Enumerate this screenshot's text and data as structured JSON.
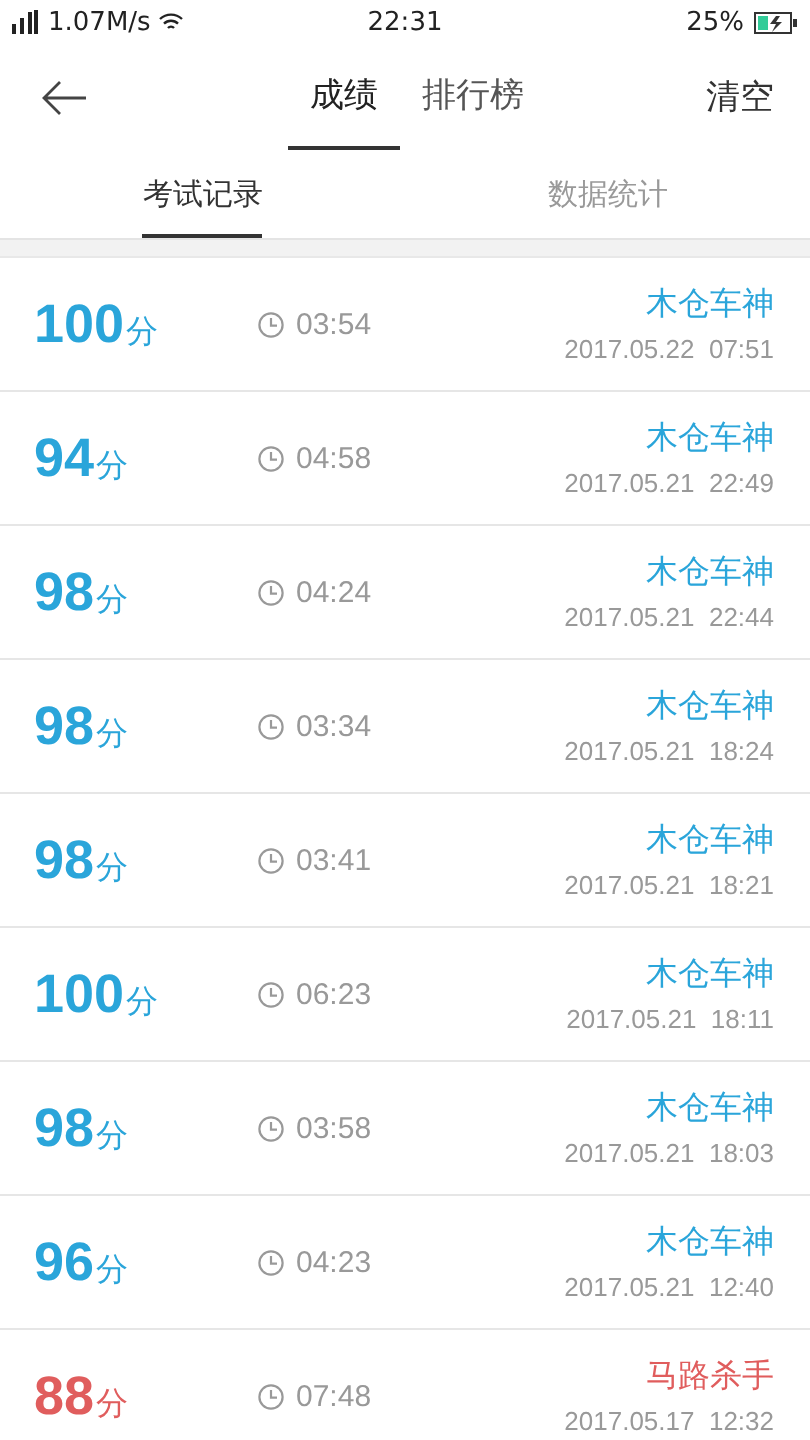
{
  "status_bar": {
    "speed": "1.07M/s",
    "time": "22:31",
    "battery": "25%"
  },
  "nav": {
    "tabs": [
      {
        "label": "成绩",
        "selected": true
      },
      {
        "label": "排行榜",
        "selected": false
      }
    ],
    "action": "清空"
  },
  "sub_tabs": [
    {
      "label": "考试记录",
      "selected": true
    },
    {
      "label": "数据统计",
      "selected": false
    }
  ],
  "records": [
    {
      "score": "100",
      "unit": "分",
      "duration": "03:54",
      "title": "木仓车神",
      "date": "2017.05.22  07:51",
      "color": "#2aa5da"
    },
    {
      "score": "94",
      "unit": "分",
      "duration": "04:58",
      "title": "木仓车神",
      "date": "2017.05.21  22:49",
      "color": "#2aa5da"
    },
    {
      "score": "98",
      "unit": "分",
      "duration": "04:24",
      "title": "木仓车神",
      "date": "2017.05.21  22:44",
      "color": "#2aa5da"
    },
    {
      "score": "98",
      "unit": "分",
      "duration": "03:34",
      "title": "木仓车神",
      "date": "2017.05.21  18:24",
      "color": "#2aa5da"
    },
    {
      "score": "98",
      "unit": "分",
      "duration": "03:41",
      "title": "木仓车神",
      "date": "2017.05.21  18:21",
      "color": "#2aa5da"
    },
    {
      "score": "100",
      "unit": "分",
      "duration": "06:23",
      "title": "木仓车神",
      "date": "2017.05.21  18:11",
      "color": "#2aa5da"
    },
    {
      "score": "98",
      "unit": "分",
      "duration": "03:58",
      "title": "木仓车神",
      "date": "2017.05.21  18:03",
      "color": "#2aa5da"
    },
    {
      "score": "96",
      "unit": "分",
      "duration": "04:23",
      "title": "木仓车神",
      "date": "2017.05.21  12:40",
      "color": "#2aa5da"
    },
    {
      "score": "88",
      "unit": "分",
      "duration": "07:48",
      "title": "马路杀手",
      "date": "2017.05.17  12:32",
      "color": "#e05d5d"
    }
  ]
}
